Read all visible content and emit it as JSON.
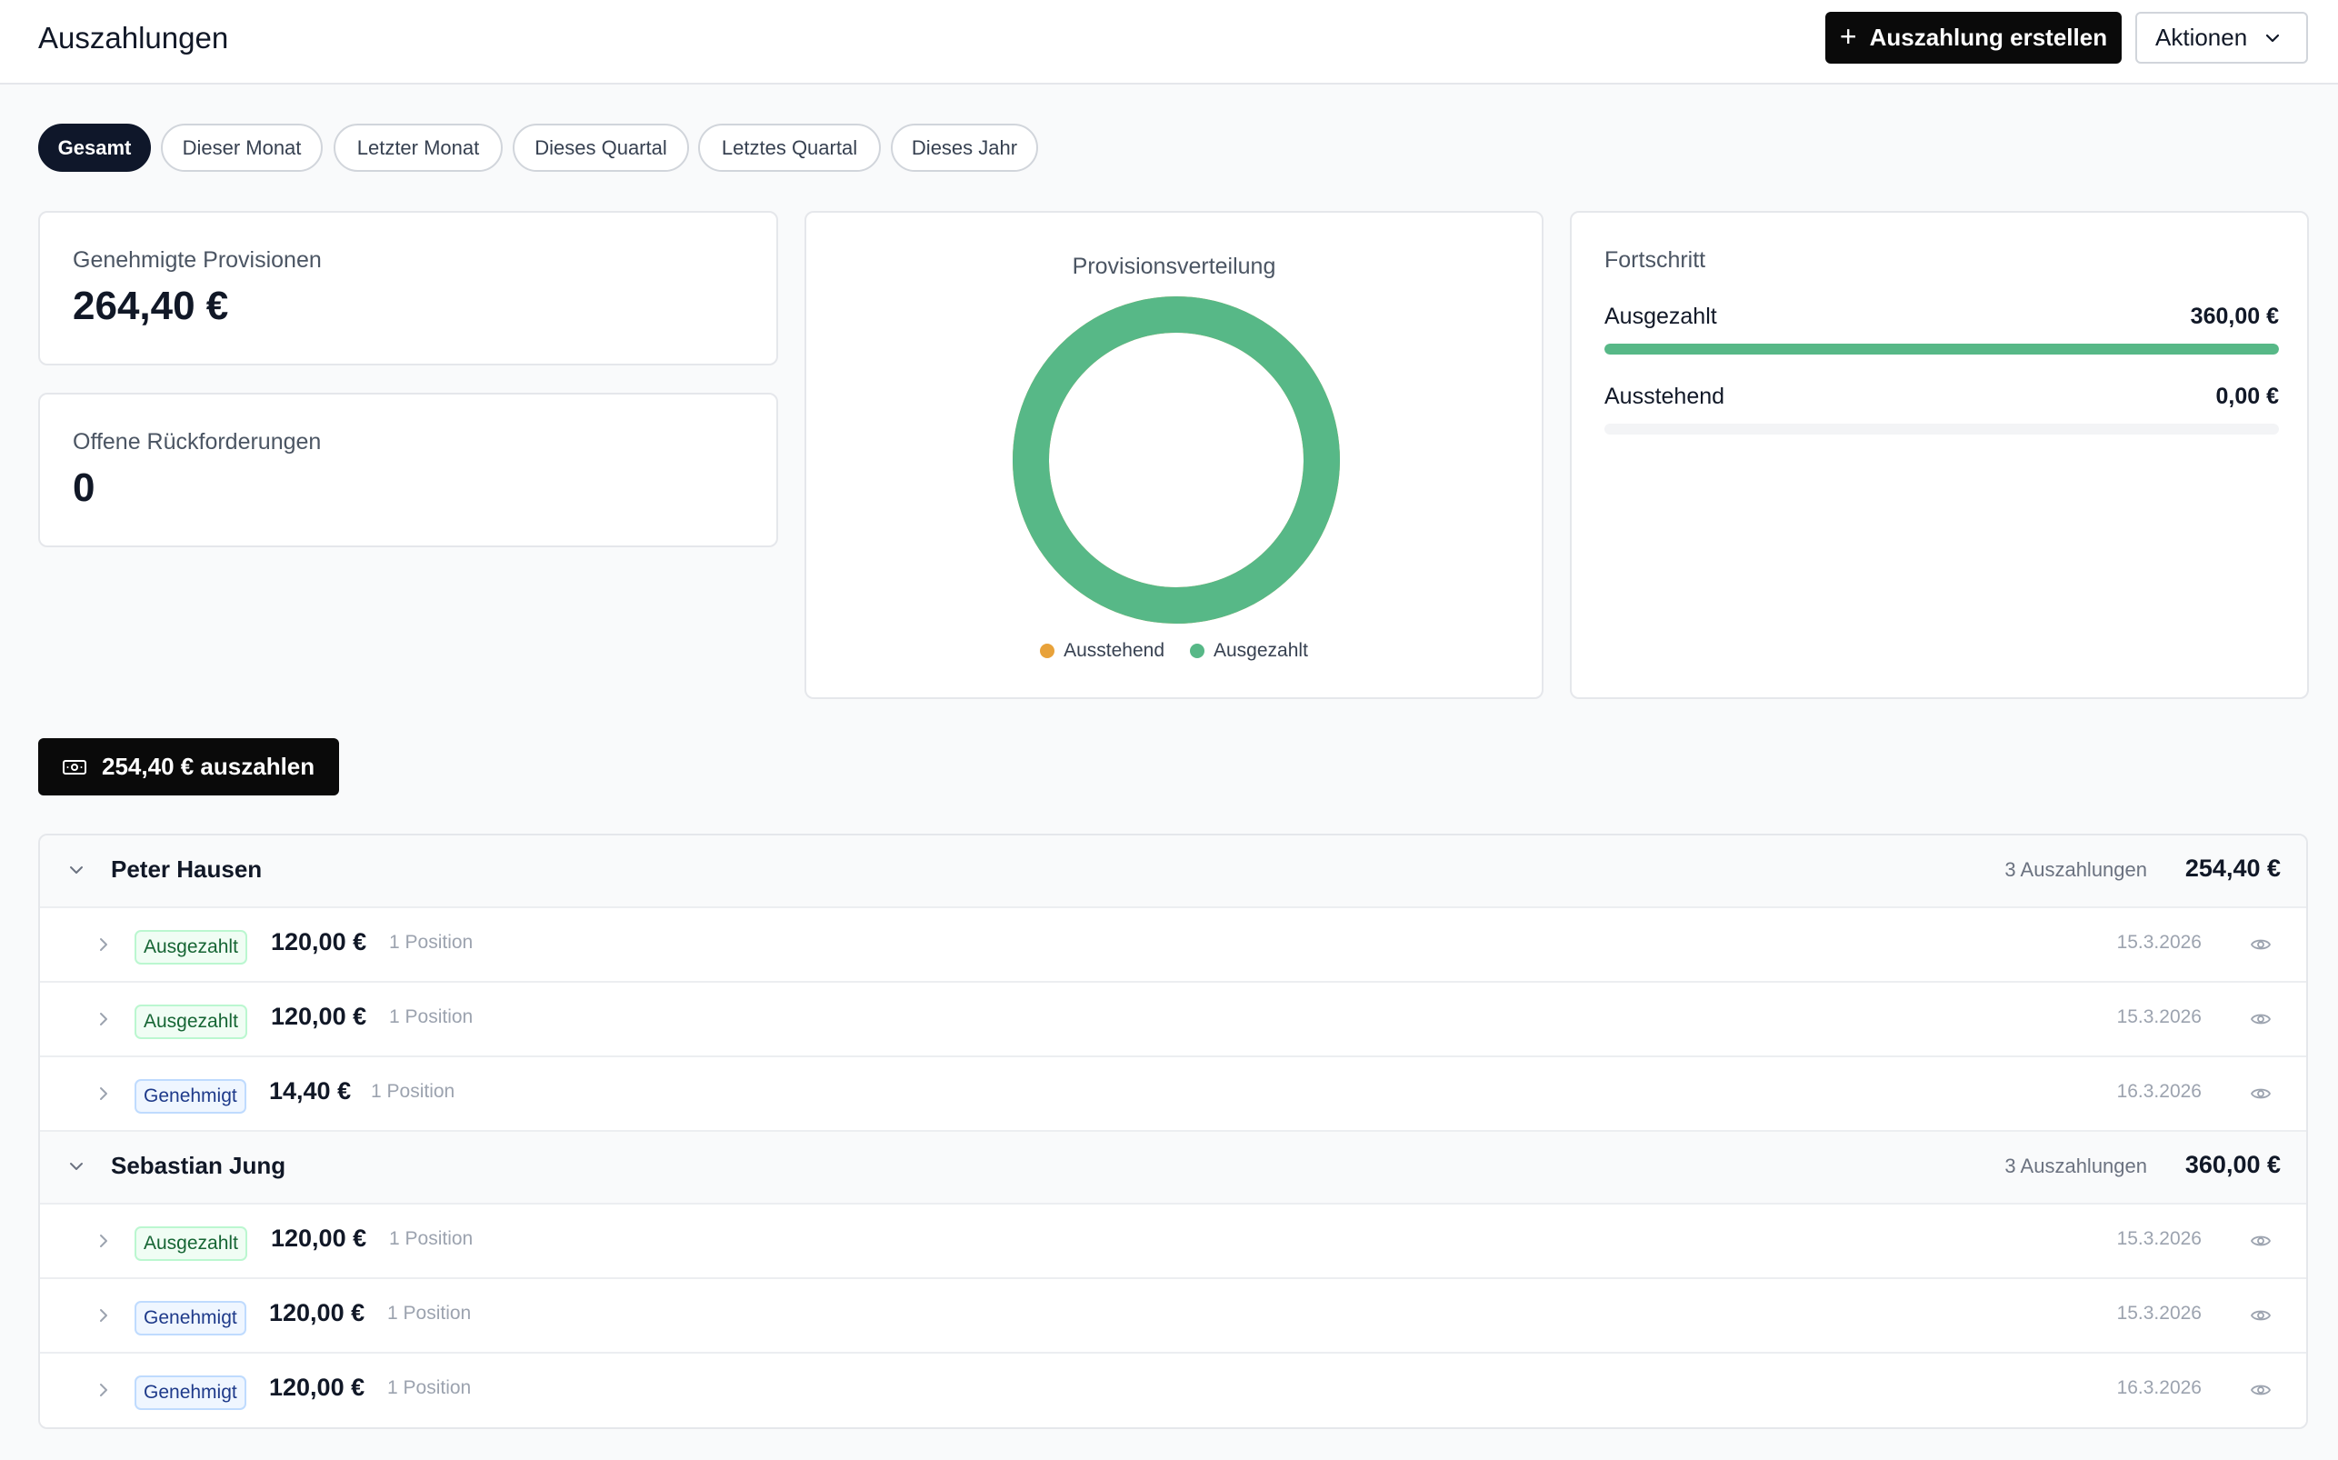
{
  "header": {
    "title": "Auszahlungen",
    "create_label": "Auszahlung erstellen",
    "actions_label": "Aktionen"
  },
  "filters": [
    {
      "label": "Gesamt",
      "active": true
    },
    {
      "label": "Dieser Monat",
      "active": false
    },
    {
      "label": "Letzter Monat",
      "active": false
    },
    {
      "label": "Dieses Quartal",
      "active": false
    },
    {
      "label": "Letztes Quartal",
      "active": false
    },
    {
      "label": "Dieses Jahr",
      "active": false
    }
  ],
  "stats": {
    "approved_label": "Genehmigte Provisionen",
    "approved_value": "264,40 €",
    "clawbacks_label": "Offene Rückforderungen",
    "clawbacks_value": "0"
  },
  "distribution": {
    "title": "Provisionsverteilung",
    "legend": [
      {
        "label": "Ausstehend",
        "color": "#e8a23a"
      },
      {
        "label": "Ausgezahlt",
        "color": "#57b887"
      }
    ],
    "share_paid": 1.0
  },
  "progress": {
    "title": "Fortschritt",
    "paid_label": "Ausgezahlt",
    "paid_amount": "360,00 €",
    "paid_fraction": 1.0,
    "pending_label": "Ausstehend",
    "pending_amount": "0,00 €",
    "pending_fraction": 0.0
  },
  "payout_button": "254,40 € auszahlen",
  "groups": [
    {
      "name": "Peter Hausen",
      "count": "3 Auszahlungen",
      "total": "254,40 €",
      "items": [
        {
          "status": "Ausgezahlt",
          "kind": "paid",
          "amount": "120,00 €",
          "positions": "1 Position",
          "date": "15.3.2026"
        },
        {
          "status": "Ausgezahlt",
          "kind": "paid",
          "amount": "120,00 €",
          "positions": "1 Position",
          "date": "15.3.2026"
        },
        {
          "status": "Genehmigt",
          "kind": "approved",
          "amount": "14,40 €",
          "positions": "1 Position",
          "date": "16.3.2026"
        }
      ]
    },
    {
      "name": "Sebastian Jung",
      "count": "3 Auszahlungen",
      "total": "360,00 €",
      "items": [
        {
          "status": "Ausgezahlt",
          "kind": "paid",
          "amount": "120,00 €",
          "positions": "1 Position",
          "date": "15.3.2026"
        },
        {
          "status": "Genehmigt",
          "kind": "approved",
          "amount": "120,00 €",
          "positions": "1 Position",
          "date": "15.3.2026"
        },
        {
          "status": "Genehmigt",
          "kind": "approved",
          "amount": "120,00 €",
          "positions": "1 Position",
          "date": "16.3.2026"
        }
      ]
    }
  ]
}
